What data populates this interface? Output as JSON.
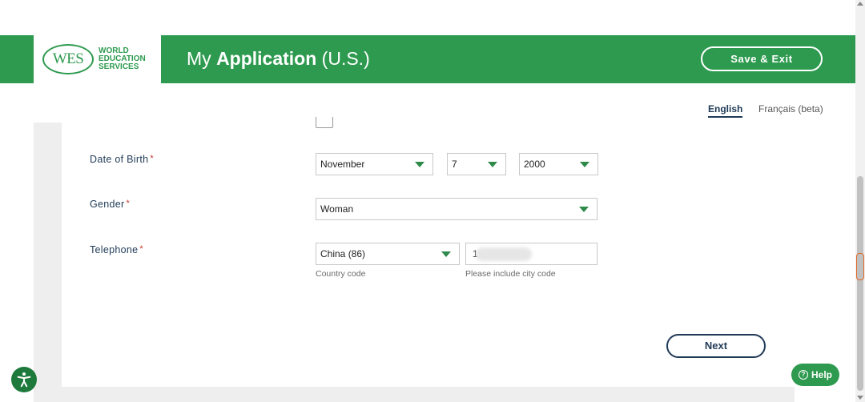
{
  "header": {
    "logo_mark": "WES",
    "logo_lines": [
      "WORLD",
      "EDUCATION",
      "SERVICES"
    ],
    "title_prefix": "My ",
    "title_bold": "Application",
    "title_suffix": " (U.S.)",
    "save_exit_label": "Save & Exit"
  },
  "language": {
    "english": "English",
    "french": "Français (beta)"
  },
  "form": {
    "dob": {
      "label": "Date of Birth",
      "required": "*",
      "month": "November",
      "day": "7",
      "year": "2000"
    },
    "gender": {
      "label": "Gender",
      "required": "*",
      "value": "Woman"
    },
    "telephone": {
      "label": "Telephone",
      "required": "*",
      "country": "China (86)",
      "number_visible": "1",
      "country_hint": "Country code",
      "number_hint": "Please include city code"
    }
  },
  "next_label": "Next",
  "help_label": "Help",
  "colors": {
    "brand_green": "#2e9a4f",
    "navy": "#1f3a57",
    "required_red": "#c0392b"
  },
  "icons": {
    "accessibility": "accessibility-icon",
    "help": "question-circle-icon",
    "dropdown": "chevron-down-icon"
  }
}
